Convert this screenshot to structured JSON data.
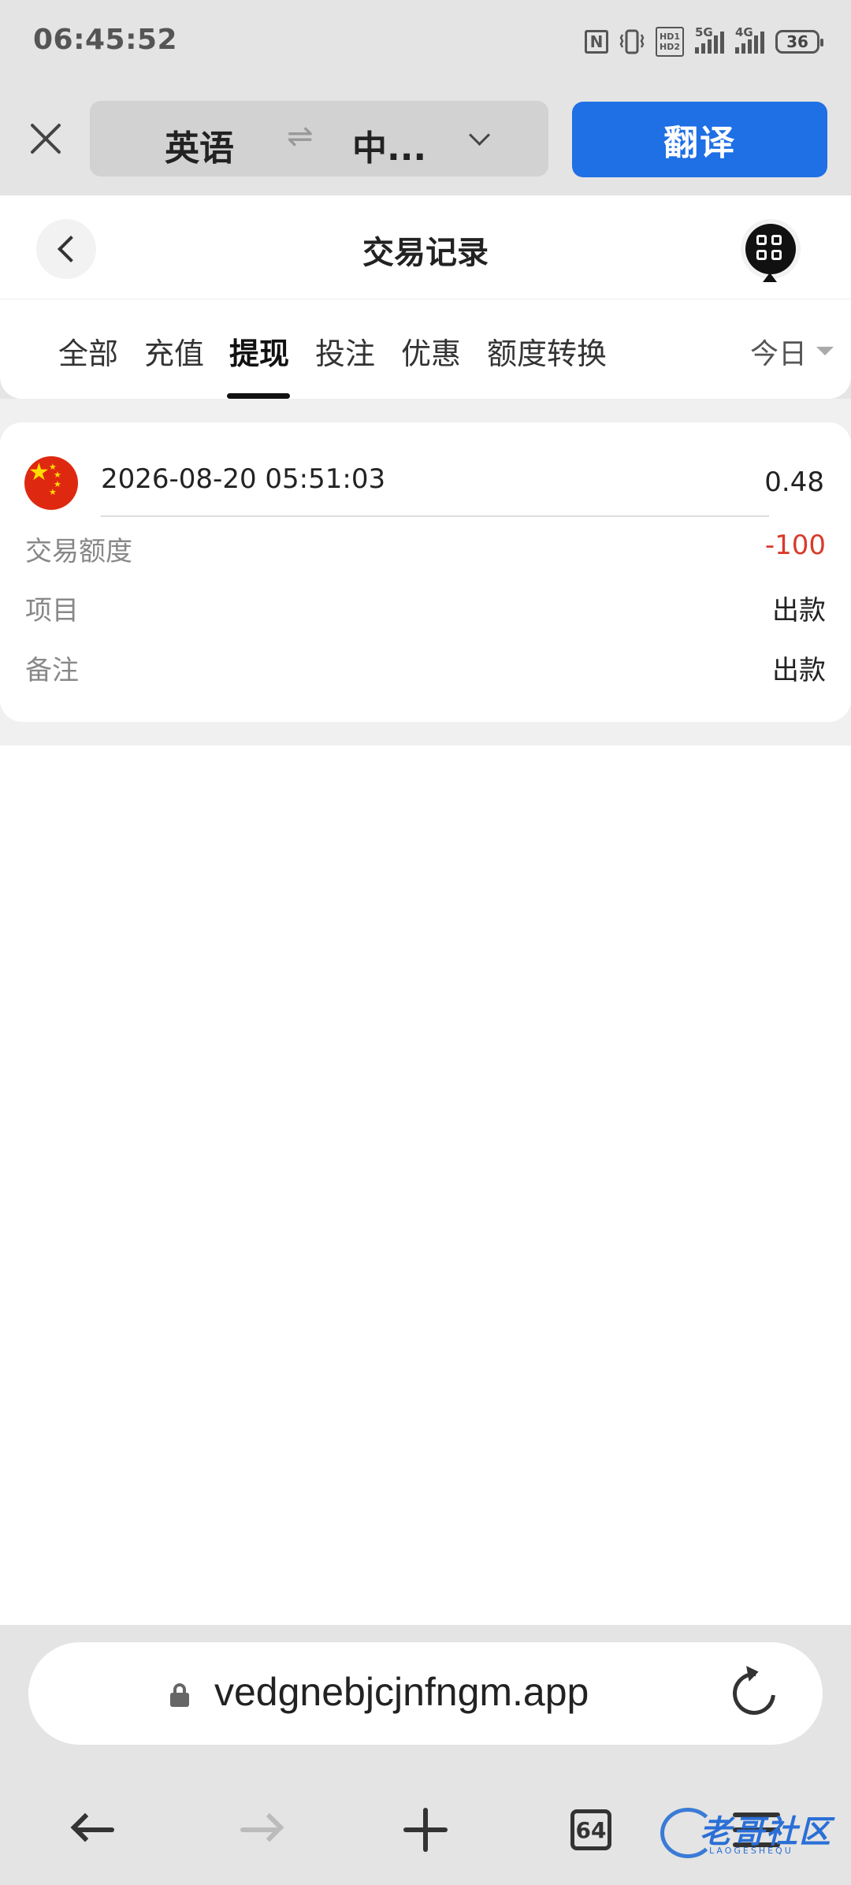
{
  "status_bar": {
    "time": "06:45:52",
    "nfc_label": "N",
    "hd_line1": "HD1",
    "hd_line2": "HD2",
    "net1": "5G",
    "net2": "4G",
    "battery": "36"
  },
  "translate_bar": {
    "source_lang": "英语",
    "swap_symbol": "⇌",
    "target_lang": "中...",
    "translate_button": "翻译"
  },
  "header": {
    "title": "交易记录"
  },
  "tabs": [
    "全部",
    "充值",
    "提现",
    "投注",
    "优惠",
    "额度转换"
  ],
  "active_tab_index": 2,
  "date_filter": "今日",
  "record": {
    "datetime": "2026-08-20 05:51:03",
    "amount": "0.48",
    "rows": [
      {
        "label": "交易额度",
        "value": "-100"
      },
      {
        "label": "项目",
        "value": "出款"
      },
      {
        "label": "备注",
        "value": "出款"
      }
    ]
  },
  "browser": {
    "url": "vedgnebjcjnfngm.app",
    "tab_count": "64"
  },
  "watermark": {
    "text": "老哥社区",
    "subtext": "LAOGESHEQU"
  },
  "colors": {
    "accent": "#1f6fe5",
    "negative": "#d93a2b"
  }
}
